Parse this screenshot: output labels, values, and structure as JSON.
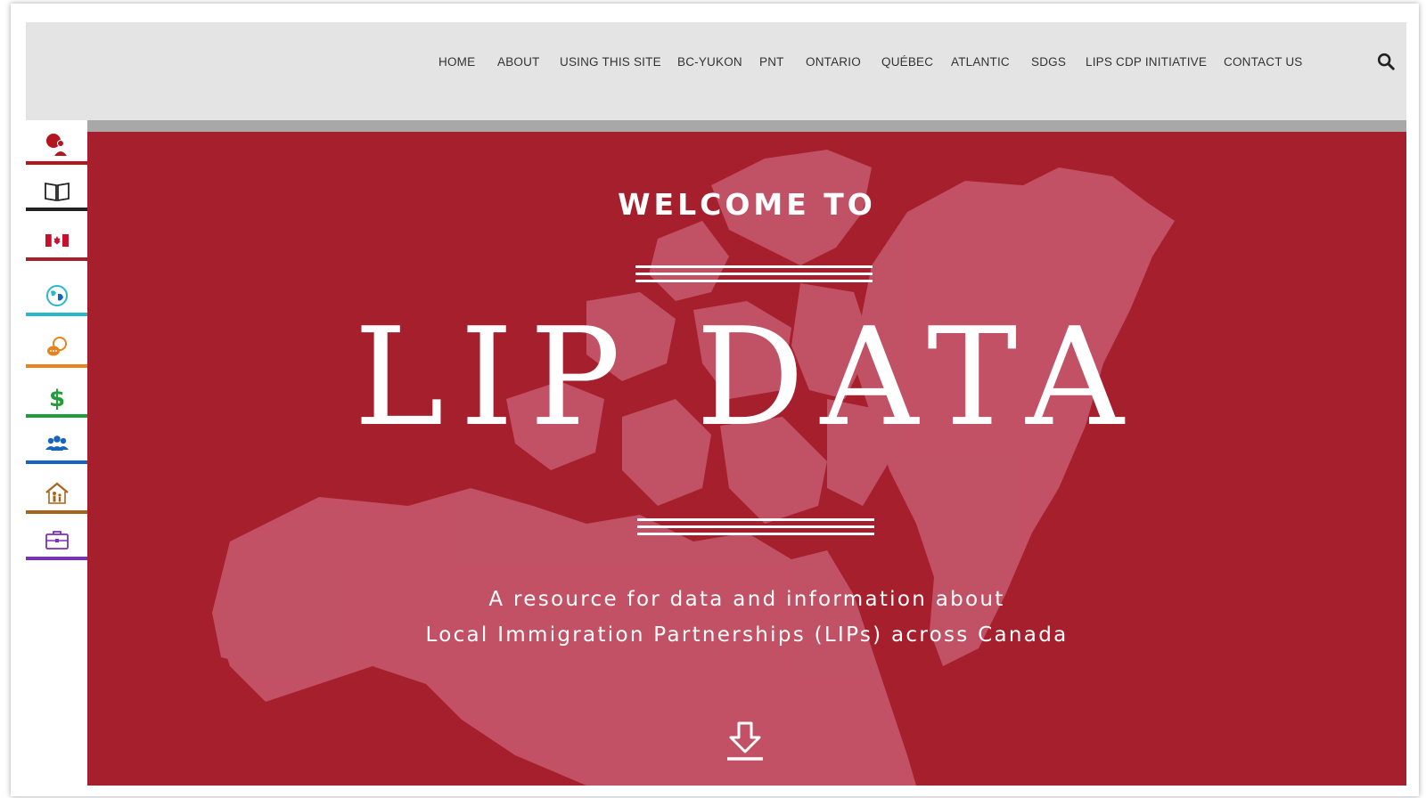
{
  "nav": {
    "items": [
      {
        "label": "HOME"
      },
      {
        "label": "ABOUT"
      },
      {
        "label": "USING THIS SITE"
      },
      {
        "label": "BC-YUKON"
      },
      {
        "label": "PNT"
      },
      {
        "label": "ONTARIO"
      },
      {
        "label": "QUÉBEC"
      },
      {
        "label": "ATLANTIC"
      },
      {
        "label": "SDGS"
      },
      {
        "label": "LIPS CDP INITIATIVE"
      },
      {
        "label": "CONTACT US"
      }
    ],
    "search_icon": "search-icon"
  },
  "hero": {
    "welcome": "WELCOME TO",
    "title": "LIP DATA",
    "tagline_line1": "A resource for data and information about",
    "tagline_line2": "Local Immigration Partnerships (LIPs) across Canada",
    "background_color": "#a61f2c",
    "arrow_icon": "down-arrow-icon"
  },
  "sidebar": {
    "items": [
      {
        "icon": "people-group-icon",
        "color": "#b3161f"
      },
      {
        "icon": "open-book-icon",
        "color": "#222222"
      },
      {
        "icon": "canada-flag-icon",
        "color": "#a61f2c"
      },
      {
        "icon": "globe-icon",
        "color": "#29b6cf"
      },
      {
        "icon": "chat-bubbles-icon",
        "color": "#e8821c"
      },
      {
        "icon": "dollar-icon",
        "color": "#1f9e3a"
      },
      {
        "icon": "community-icon",
        "color": "#1565c0"
      },
      {
        "icon": "family-home-icon",
        "color": "#a8641a"
      },
      {
        "icon": "briefcase-icon",
        "color": "#7b2fbe"
      }
    ]
  }
}
